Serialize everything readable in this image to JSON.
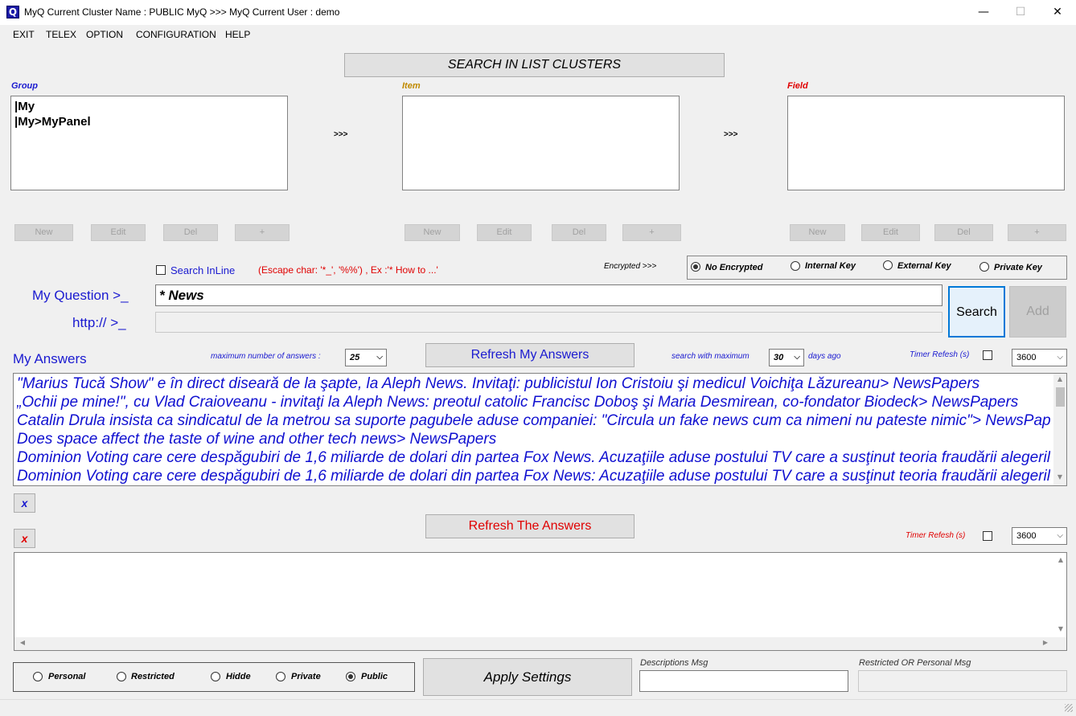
{
  "window": {
    "app_icon": "Q",
    "title": "MyQ Current Cluster Name : PUBLIC MyQ >>> MyQ Current User : demo",
    "minimize_glyph": "—",
    "maximize_glyph": "☐",
    "close_glyph": "✕"
  },
  "menu": [
    "EXIT",
    "TELEX",
    "OPTION",
    "CONFIGURATION",
    "HELP"
  ],
  "search_clusters_button": "SEARCH IN LIST CLUSTERS",
  "group": {
    "label": "Group",
    "items": [
      "|My",
      "|My>MyPanel"
    ],
    "color": "#1a1ad0"
  },
  "item": {
    "label": "Item",
    "color": "#c08a00"
  },
  "field": {
    "label": "Field",
    "color": "#e00000"
  },
  "arrows": ">>>",
  "list_buttons": {
    "new": "New",
    "edit": "Edit",
    "del": "Del",
    "plus": "+"
  },
  "search_inline_label": "Search InLine",
  "escape_hint": "(Escape char: '*_', '%%') , Ex :'* How to ...'",
  "encrypted_label": "Encrypted >>>",
  "encryption_options": [
    {
      "label": "No Encrypted",
      "selected": true
    },
    {
      "label": "Internal Key",
      "selected": false
    },
    {
      "label": "External Key",
      "selected": false
    },
    {
      "label": "Private Key",
      "selected": false
    }
  ],
  "question_label": "My Question >_",
  "question_value": "* News",
  "url_label": "http:// >_",
  "url_value": "",
  "search_button": "Search",
  "add_button": "Add",
  "my_answers_label": "My Answers",
  "max_answers_label": "maximum number of answers :",
  "max_answers_value": "25",
  "refresh_my_answers": "Refresh My Answers",
  "search_with_max_label": "search with maximum",
  "days_value": "30",
  "days_ago_label": "days ago",
  "timer_refresh_label": "Timer Refesh (s)",
  "timer_value": "3600",
  "answers": [
    "\"Marius Tucă Show\" e în direct diseară de la şapte, la Aleph News. Invitaţi: publicistul Ion Cristoiu şi medicul Voichiţa Lăzureanu> NewsPapers",
    "„Ochii pe mine!\", cu Vlad Craioveanu - invitaţi la Aleph News: preotul catolic Francisc Doboş şi Maria Desmirean, co-fondator Biodeck> NewsPapers",
    "Catalin Drula insista ca sindicatul de la metrou sa suporte pagubele aduse companiei: \"Circula un fake news cum ca nimeni nu pateste nimic\"> NewsPapers",
    "Does space affect the taste of wine and other tech news> NewsPapers",
    "Dominion Voting care cere despăgubiri de 1,6 miliarde de dolari din partea Fox News. Acuzaţiile aduse postului TV care a susţinut teoria fraudării alegerilor",
    "Dominion Voting care cere despăgubiri de 1,6 miliarde de dolari din partea Fox News: Acuzaţiile aduse postului TV care a susţinut teoria fraudării alegerilor"
  ],
  "clear_x": "x",
  "refresh_the_answers": "Refresh The Answers",
  "timer_refresh_label_2": "Timer Refesh (s)",
  "timer_value_2": "3600",
  "visibility_options": [
    {
      "label": "Personal",
      "selected": false
    },
    {
      "label": "Restricted",
      "selected": false
    },
    {
      "label": "Hidde",
      "selected": false
    },
    {
      "label": "Private",
      "selected": false
    },
    {
      "label": "Public",
      "selected": true
    }
  ],
  "apply_settings": "Apply Settings",
  "descriptions_msg_label": "Descriptions Msg",
  "descriptions_msg_value": "",
  "restricted_msg_label": "Restricted OR Personal Msg",
  "restricted_msg_value": "",
  "colors": {
    "blue": "#1a1ad0",
    "red": "#e00000",
    "answer_blue": "#1010d0"
  }
}
